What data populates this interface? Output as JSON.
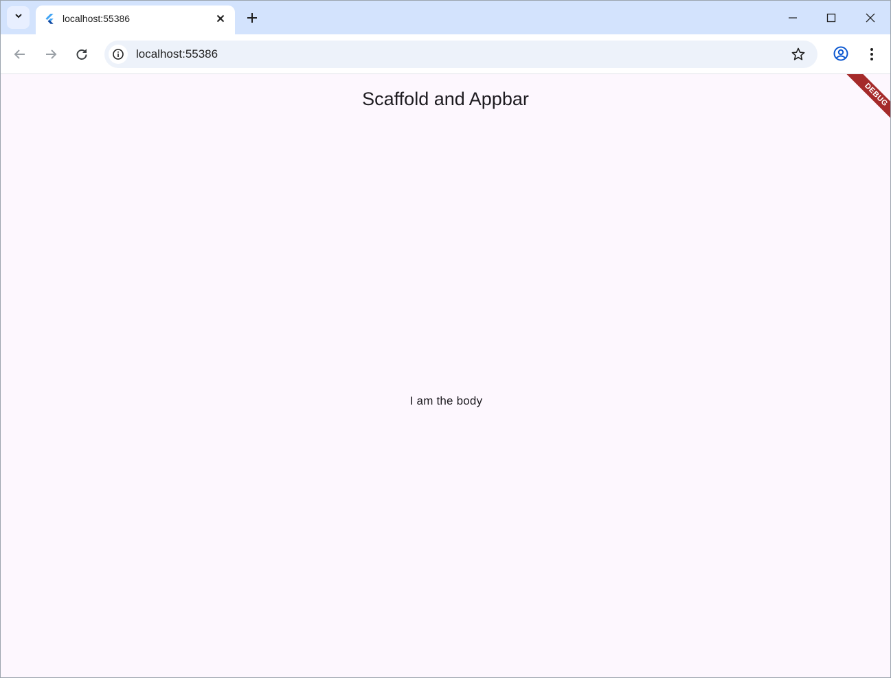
{
  "browser": {
    "tab": {
      "title": "localhost:55386"
    },
    "address_bar": {
      "url": "localhost:55386"
    }
  },
  "app": {
    "appbar_title": "Scaffold and Appbar",
    "body_text": "I am the body",
    "debug_banner": "DEBUG"
  },
  "colors": {
    "tabstrip": "#d3e3fd",
    "page_background": "#fdf7fe",
    "debug_banner": "#a52a2a",
    "profile_icon": "#0b57d0",
    "flutter_logo": "#42a5f5"
  },
  "icons": [
    "tab-search-icon",
    "flutter-logo-icon",
    "tab-close-icon",
    "new-tab-icon",
    "minimize-icon",
    "maximize-icon",
    "window-close-icon",
    "back-icon",
    "forward-icon",
    "reload-icon",
    "site-info-icon",
    "bookmark-star-icon",
    "profile-icon",
    "menu-icon"
  ]
}
